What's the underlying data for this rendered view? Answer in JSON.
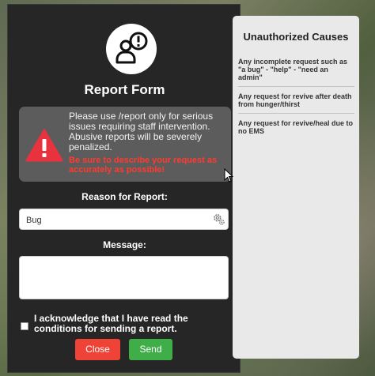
{
  "form": {
    "title": "Report Form",
    "warning_text": "Please use /report only for serious issues requiring staff intervention. Abusive reports will be severely penalized.",
    "warning_emphasis": "Be sure to describe your request as accurately as possible!",
    "reason_label": "Reason for Report:",
    "reason_value": "Bug",
    "message_label": "Message:",
    "message_value": "",
    "acknowledge_text": "I acknowledge that I have read the conditions for sending a report.",
    "acknowledge_checked": false,
    "close_label": "Close",
    "send_label": "Send"
  },
  "side": {
    "title": "Unauthorized Causes",
    "causes": [
      "Any incomplete request such as \"a bug\" - \"help\" - \"need an admin\"",
      "Any request for revive after death from hunger/thirst",
      "Any request for revive/heal due to no EMS"
    ]
  },
  "icons": {
    "logo": "user-alert-icon",
    "warning": "warning-triangle-icon",
    "reason_picker": "gear-icon"
  },
  "colors": {
    "close": "#ee4336",
    "send": "#3fae48",
    "warning_red": "#ff3b2f",
    "warning_icon": "#e8333f"
  }
}
